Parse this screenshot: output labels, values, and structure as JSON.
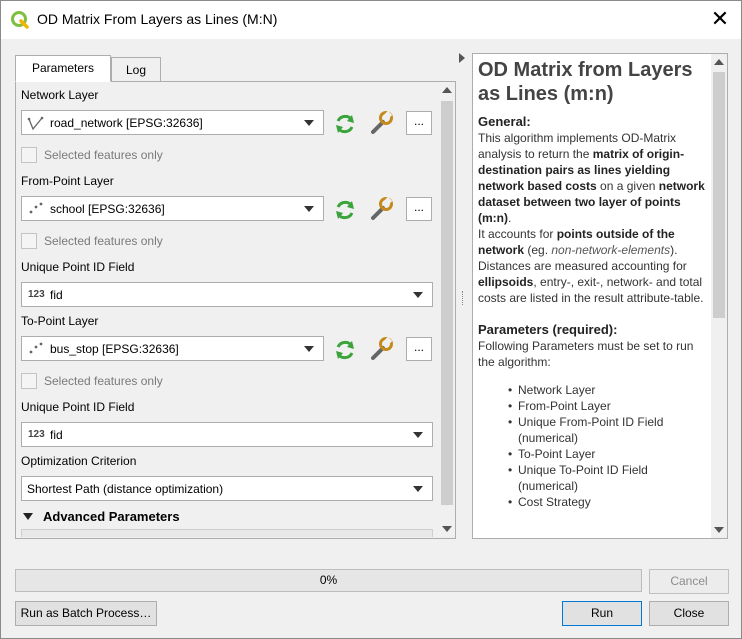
{
  "window": {
    "title": "OD Matrix From Layers as Lines (M:N)",
    "close_glyph": "✕"
  },
  "tabs": [
    {
      "label": "Parameters",
      "active": true
    },
    {
      "label": "Log",
      "active": false
    }
  ],
  "params": {
    "network_layer_label": "Network Layer",
    "network_layer_value": "road_network [EPSG:32636]",
    "selected_only_label": "Selected features only",
    "from_point_label": "From-Point Layer",
    "from_point_value": "school [EPSG:32636]",
    "unique_id_label_1": "Unique Point ID Field",
    "unique_id_type_1": "123",
    "unique_id_value_1": "fid",
    "to_point_label": "To-Point Layer",
    "to_point_value": "bus_stop [EPSG:32636]",
    "unique_id_label_2": "Unique Point ID Field",
    "unique_id_type_2": "123",
    "unique_id_value_2": "fid",
    "optimization_label": "Optimization Criterion",
    "optimization_value": "Shortest Path (distance optimization)",
    "advanced_label": "Advanced Parameters",
    "dots": "..."
  },
  "help": {
    "title": "OD Matrix from Layers as Lines (m:n)",
    "general_heading": "General:",
    "t1": "This algorithm implements OD-Matrix analysis to return the ",
    "b1": "matrix of origin-destination pairs as lines yielding network based costs",
    "t2": " on a given ",
    "b2": "network dataset between two layer of points (m:n)",
    "t3": ".",
    "t4": "It accounts for ",
    "b3": "points outside of the network",
    "t5": " (eg. ",
    "i1": "non-network-elements",
    "t6": "). Distances are measured accounting for ",
    "b4": "ellipsoids",
    "t7": ", entry-, exit-, network- and total costs are listed in the result attribute-table.",
    "params_heading": "Parameters (required):",
    "params_text": "Following Parameters must be set to run the algorithm:",
    "items": [
      "Network Layer",
      "From-Point Layer",
      "Unique From-Point ID Field (numerical)",
      "To-Point Layer",
      "Unique To-Point ID Field (numerical)",
      "Cost Strategy"
    ]
  },
  "footer": {
    "progress_text": "0%",
    "progress_value": 0,
    "cancel_label": "Cancel",
    "batch_label": "Run as Batch Process…",
    "run_label": "Run",
    "close_label": "Close"
  },
  "colors": {
    "refresh_icon": "#3aa33a",
    "accent": "#0078d7"
  }
}
